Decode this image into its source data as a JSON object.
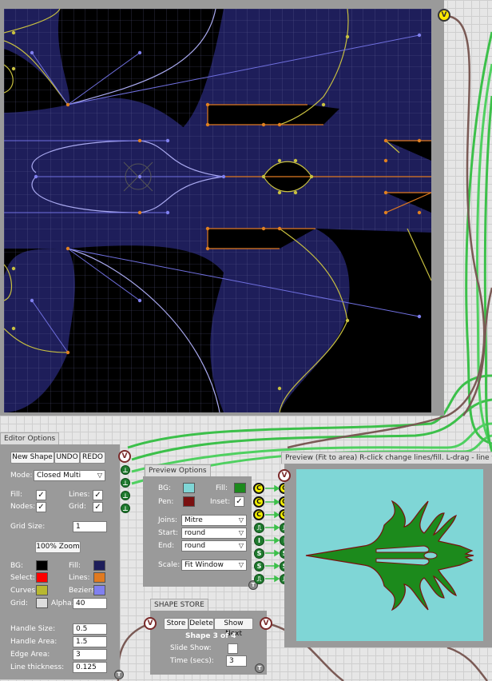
{
  "colors": {
    "wire_green": "#3cc04a",
    "wire_brown": "#7a5a55",
    "canvas_bg": "#000000",
    "canvas_fill": "#1e1e5a",
    "curves": "#b8b830",
    "beziers": "#8080f0",
    "lines": "#e07a20",
    "preview_bg": "#7fd6d6",
    "shape_fill": "#1c8a1c",
    "shape_pen": "#7a1010"
  },
  "editor": {
    "tab": "Editor Options",
    "new_shape": "New Shape",
    "undo": "UNDO",
    "redo": "REDO",
    "mode_label": "Mode:",
    "mode_value": "Closed Multi",
    "fill_label": "Fill:",
    "lines_label": "Lines:",
    "nodes_label": "Nodes:",
    "grid_label": "Grid:",
    "fill_checked": "✓",
    "lines_checked": "✓",
    "nodes_checked": "✓",
    "grid_checked": "✓",
    "grid_size_label": "Grid Size:",
    "grid_size_value": "1",
    "zoom_button": "100% Zoom",
    "bg_label": "BG:",
    "fill2_label": "Fill:",
    "select_label": "Select:",
    "lines2_label": "Lines:",
    "curves_label": "Curves:",
    "beziers_label": "Beziers:",
    "grid2_label": "Grid:",
    "alpha_label": "Alpha:",
    "alpha_value": "40",
    "handle_size_label": "Handle Size:",
    "handle_size_value": "0.5",
    "handle_area_label": "Handle Area:",
    "handle_area_value": "1.5",
    "edge_area_label": "Edge Area:",
    "edge_area_value": "3",
    "line_thickness_label": "Line thickness:",
    "line_thickness_value": "0.125",
    "swatches": {
      "bg": "#000000",
      "fill": "#1e1e5a",
      "select": "#ff0000",
      "lines": "#e07a20",
      "curves": "#b8b830",
      "beziers": "#8080f0",
      "grid": "#dddddd"
    }
  },
  "preview_options": {
    "tab": "Preview Options",
    "bg_label": "BG:",
    "fill_label": "Fill:",
    "pen_label": "Pen:",
    "inset_label": "Inset:",
    "inset_checked": "✓",
    "joins_label": "Joins:",
    "joins_value": "Mitre",
    "start_label": "Start:",
    "start_value": "round",
    "end_label": "End:",
    "end_value": "round",
    "scale_label": "Scale:",
    "scale_value": "Fit Window",
    "swatches": {
      "bg": "#7fd6d6",
      "fill": "#1c8a1c",
      "pen": "#7a1010"
    }
  },
  "store": {
    "tab": "SHAPE STORE",
    "store": "Store",
    "delete": "Delete",
    "show_next": "Show Next",
    "status": "Shape 3 of 4",
    "slide_show_label": "Slide Show:",
    "time_label": "Time (secs):",
    "time_value": "3"
  },
  "preview": {
    "title": "Preview (Fit to area) R-click change lines/fill. L-drag - line thickness"
  },
  "ports": {
    "v": "V",
    "c": "C",
    "s": "S",
    "i": "I",
    "t": "T",
    "sq": "⎍",
    "perp": "⊥"
  }
}
